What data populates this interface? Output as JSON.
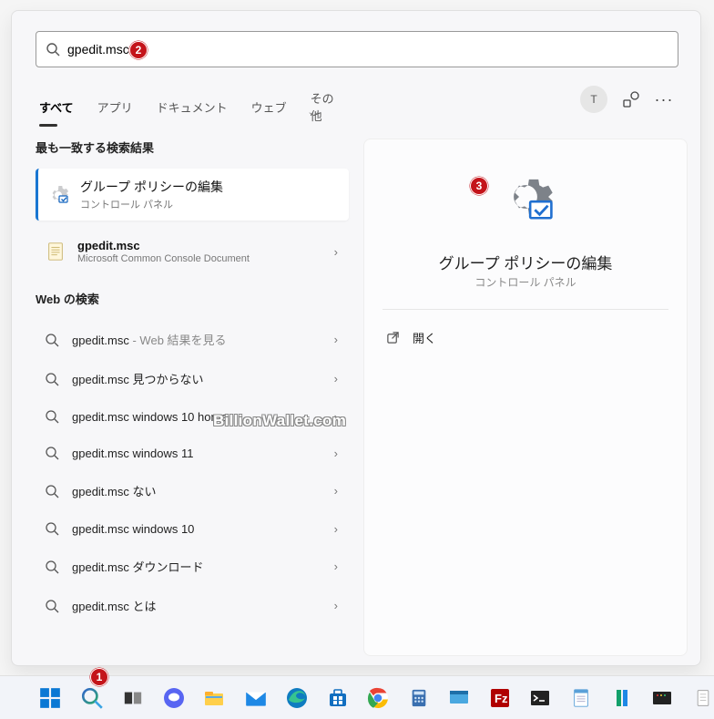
{
  "search": {
    "value": "gpedit.msc"
  },
  "tabs": {
    "items": [
      {
        "label": "すべて",
        "active": true
      },
      {
        "label": "アプリ"
      },
      {
        "label": "ドキュメント"
      },
      {
        "label": "ウェブ"
      },
      {
        "label": "その他"
      }
    ]
  },
  "avatar_initial": "T",
  "sections": {
    "best_match": "最も一致する検索結果",
    "web": "Web の検索"
  },
  "best_match": {
    "title": "グループ ポリシーの編集",
    "subtitle": "コントロール パネル"
  },
  "doc_result": {
    "title": "gpedit.msc",
    "subtitle": "Microsoft Common Console Document"
  },
  "web_results": [
    {
      "bold": "gpedit.msc",
      "grey": " - Web 結果を見る"
    },
    {
      "bold": "gpedit.msc 見つからない"
    },
    {
      "bold": "gpedit.msc windows 10 home"
    },
    {
      "bold": "gpedit.msc windows 11"
    },
    {
      "bold": "gpedit.msc ない"
    },
    {
      "bold": "gpedit.msc windows 10"
    },
    {
      "bold": "gpedit.msc ダウンロード"
    },
    {
      "bold": "gpedit.msc とは"
    }
  ],
  "detail": {
    "title": "グループ ポリシーの編集",
    "subtitle": "コントロール パネル",
    "open_label": "開く"
  },
  "watermark": "BillionWallet.com",
  "annotations": {
    "a1": "1",
    "a2": "2",
    "a3": "3"
  }
}
